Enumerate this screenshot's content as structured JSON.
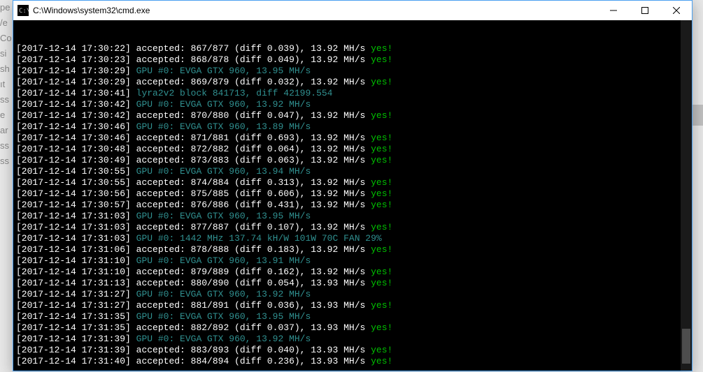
{
  "bg_lines": [
    "",
    "",
    "",
    "",
    "",
    "",
    "",
    "",
    "",
    "",
    "",
    "pe",
    "/e",
    "Co",
    "si",
    "sh",
    "",
    "",
    "ıt",
    "",
    "",
    "ss",
    "e",
    "ar",
    "ss",
    "ss"
  ],
  "window": {
    "title": "C:\\Windows\\system32\\cmd.exe",
    "icon_name": "cmd-icon"
  },
  "colors": {
    "timestamp": "#ffffff",
    "message": "#ffffff",
    "info": "#309090",
    "ok": "#00c000",
    "bg": "#000000"
  },
  "log": [
    {
      "ts": "[2017-12-14 17:30:22]",
      "type": "accepted",
      "text": "accepted: 867/877 (diff 0.039), 13.92 MH/s",
      "tail": "yes!"
    },
    {
      "ts": "[2017-12-14 17:30:23]",
      "type": "accepted",
      "text": "accepted: 868/878 (diff 0.049), 13.92 MH/s",
      "tail": "yes!"
    },
    {
      "ts": "[2017-12-14 17:30:29]",
      "type": "info",
      "text": "GPU #0: EVGA GTX 960, 13.95 MH/s"
    },
    {
      "ts": "[2017-12-14 17:30:29]",
      "type": "accepted",
      "text": "accepted: 869/879 (diff 0.032), 13.92 MH/s",
      "tail": "yes!"
    },
    {
      "ts": "[2017-12-14 17:30:41]",
      "type": "block",
      "text": "lyra2v2 block 841713, diff 42199.554"
    },
    {
      "ts": "[2017-12-14 17:30:42]",
      "type": "info",
      "text": "GPU #0: EVGA GTX 960, 13.92 MH/s"
    },
    {
      "ts": "[2017-12-14 17:30:42]",
      "type": "accepted",
      "text": "accepted: 870/880 (diff 0.047), 13.92 MH/s",
      "tail": "yes!"
    },
    {
      "ts": "[2017-12-14 17:30:46]",
      "type": "info",
      "text": "GPU #0: EVGA GTX 960, 13.89 MH/s"
    },
    {
      "ts": "[2017-12-14 17:30:46]",
      "type": "accepted",
      "text": "accepted: 871/881 (diff 0.693), 13.92 MH/s",
      "tail": "yes!"
    },
    {
      "ts": "[2017-12-14 17:30:48]",
      "type": "accepted",
      "text": "accepted: 872/882 (diff 0.064), 13.92 MH/s",
      "tail": "yes!"
    },
    {
      "ts": "[2017-12-14 17:30:49]",
      "type": "accepted",
      "text": "accepted: 873/883 (diff 0.063), 13.92 MH/s",
      "tail": "yes!"
    },
    {
      "ts": "[2017-12-14 17:30:55]",
      "type": "info",
      "text": "GPU #0: EVGA GTX 960, 13.94 MH/s"
    },
    {
      "ts": "[2017-12-14 17:30:55]",
      "type": "accepted",
      "text": "accepted: 874/884 (diff 0.313), 13.92 MH/s",
      "tail": "yes!"
    },
    {
      "ts": "[2017-12-14 17:30:56]",
      "type": "accepted",
      "text": "accepted: 875/885 (diff 0.606), 13.92 MH/s",
      "tail": "yes!"
    },
    {
      "ts": "[2017-12-14 17:30:57]",
      "type": "accepted",
      "text": "accepted: 876/886 (diff 0.431), 13.92 MH/s",
      "tail": "yes!"
    },
    {
      "ts": "[2017-12-14 17:31:03]",
      "type": "info",
      "text": "GPU #0: EVGA GTX 960, 13.95 MH/s"
    },
    {
      "ts": "[2017-12-14 17:31:03]",
      "type": "accepted",
      "text": "accepted: 877/887 (diff 0.107), 13.92 MH/s",
      "tail": "yes!"
    },
    {
      "ts": "[2017-12-14 17:31:03]",
      "type": "info",
      "text": "GPU #0: 1442 MHz 137.74 kH/W 101W 70C FAN 29%"
    },
    {
      "ts": "[2017-12-14 17:31:06]",
      "type": "accepted",
      "text": "accepted: 878/888 (diff 0.183), 13.92 MH/s",
      "tail": "yes!"
    },
    {
      "ts": "[2017-12-14 17:31:10]",
      "type": "info",
      "text": "GPU #0: EVGA GTX 960, 13.91 MH/s"
    },
    {
      "ts": "[2017-12-14 17:31:10]",
      "type": "accepted",
      "text": "accepted: 879/889 (diff 0.162), 13.92 MH/s",
      "tail": "yes!"
    },
    {
      "ts": "[2017-12-14 17:31:13]",
      "type": "accepted",
      "text": "accepted: 880/890 (diff 0.054), 13.93 MH/s",
      "tail": "yes!"
    },
    {
      "ts": "[2017-12-14 17:31:27]",
      "type": "info",
      "text": "GPU #0: EVGA GTX 960, 13.92 MH/s"
    },
    {
      "ts": "[2017-12-14 17:31:27]",
      "type": "accepted",
      "text": "accepted: 881/891 (diff 0.036), 13.93 MH/s",
      "tail": "yes!"
    },
    {
      "ts": "[2017-12-14 17:31:35]",
      "type": "info",
      "text": "GPU #0: EVGA GTX 960, 13.95 MH/s"
    },
    {
      "ts": "[2017-12-14 17:31:35]",
      "type": "accepted",
      "text": "accepted: 882/892 (diff 0.037), 13.93 MH/s",
      "tail": "yes!"
    },
    {
      "ts": "[2017-12-14 17:31:39]",
      "type": "info",
      "text": "GPU #0: EVGA GTX 960, 13.92 MH/s"
    },
    {
      "ts": "[2017-12-14 17:31:39]",
      "type": "accepted",
      "text": "accepted: 883/893 (diff 0.040), 13.93 MH/s",
      "tail": "yes!"
    },
    {
      "ts": "[2017-12-14 17:31:40]",
      "type": "accepted",
      "text": "accepted: 884/894 (diff 0.236), 13.93 MH/s",
      "tail": "yes!"
    }
  ]
}
